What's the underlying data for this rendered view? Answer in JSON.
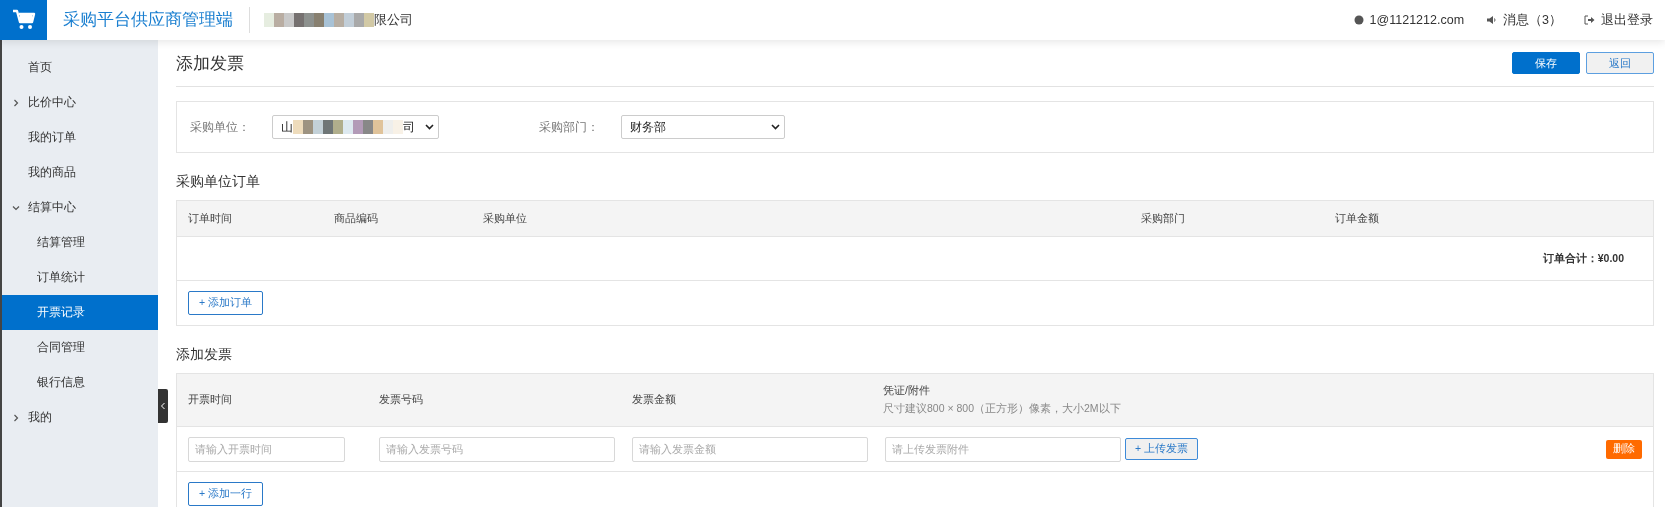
{
  "header": {
    "app_title": "采购平台供应商管理端",
    "company_tail": "限公司",
    "user": "1@1121212.com",
    "messages": "消息（3）",
    "logout": "退出登录"
  },
  "sidebar": {
    "items": [
      {
        "label": "首页",
        "selected": false
      },
      {
        "label": "比价中心",
        "selected": false,
        "expanded": false
      },
      {
        "label": "我的订单",
        "selected": false
      },
      {
        "label": "我的商品",
        "selected": false
      },
      {
        "label": "结算中心",
        "selected": false,
        "expanded": true,
        "children": [
          {
            "label": "结算管理",
            "selected": false
          },
          {
            "label": "订单统计",
            "selected": false
          },
          {
            "label": "开票记录",
            "selected": true
          },
          {
            "label": "合同管理",
            "selected": false
          },
          {
            "label": "银行信息",
            "selected": false
          }
        ]
      },
      {
        "label": "我的",
        "selected": false,
        "expanded": false
      }
    ]
  },
  "page": {
    "title": "添加发票",
    "buttons": [
      {
        "label": "保存",
        "kind": "primary"
      },
      {
        "label": "返回",
        "kind": "secondary"
      }
    ]
  },
  "filters": [
    {
      "label": "采购单位：",
      "value_start": "山",
      "value_end": "司"
    },
    {
      "label": "采购部门：",
      "value": "财务部"
    }
  ],
  "orders": {
    "title": "采购单位订单",
    "columns": [
      "订单时间",
      "商品编码",
      "采购单位",
      "采购部门",
      "订单金额"
    ],
    "total": "订单合计：¥0.00",
    "add_button": "+ 添加订单"
  },
  "invoices": {
    "title": "添加发票",
    "columns": [
      {
        "label": "开票时间"
      },
      {
        "label": "发票号码"
      },
      {
        "label": "发票金额"
      },
      {
        "label": "凭证/附件",
        "hint": "尺寸建议800 × 800（正方形）像素，大小2M以下"
      }
    ],
    "row": {
      "fields": [
        {
          "placeholder": "请输入开票时间"
        },
        {
          "placeholder": "请输入发票号码"
        },
        {
          "placeholder": "请输入发票金额"
        },
        {
          "placeholder": "请上传发票附件"
        }
      ],
      "upload_button": "+ 上传发票",
      "delete_button": "删除"
    },
    "add_button": "+ 添加一行"
  }
}
